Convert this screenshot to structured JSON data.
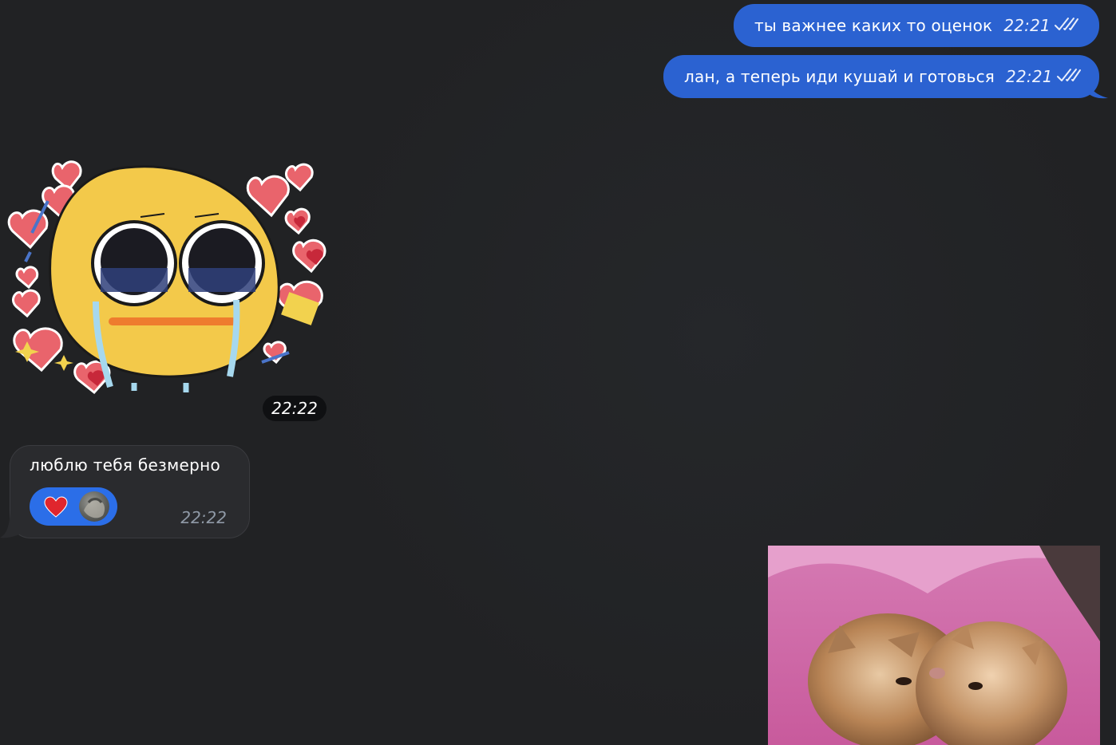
{
  "conversation": {
    "messages": [
      {
        "direction": "outgoing",
        "text": "ты важнее каких то оценок",
        "time": "22:21",
        "status_icon": "double-check-icon"
      },
      {
        "direction": "outgoing",
        "text": "лан, а теперь иди кушай и готовься",
        "time": "22:21",
        "status_icon": "double-check-icon"
      },
      {
        "direction": "incoming",
        "type": "sticker",
        "sticker_icon": "crying-heart-emoji-sticker",
        "time": "22:22"
      },
      {
        "direction": "incoming",
        "text": "люблю тебя безмерно",
        "time": "22:22",
        "reaction": {
          "emoji": "♥",
          "reaction_icon": "red-heart-icon",
          "avatar_icon": "user-avatar-icon"
        }
      },
      {
        "direction": "outgoing",
        "type": "media",
        "media_icon": "kissing-kittens-image"
      }
    ]
  },
  "colors": {
    "background": "#212224",
    "outgoing_bubble": "#2b62d1",
    "incoming_bubble": "#2a2b2e",
    "reaction_pill": "#2b6ee8",
    "muted_time": "#8f99a6"
  }
}
